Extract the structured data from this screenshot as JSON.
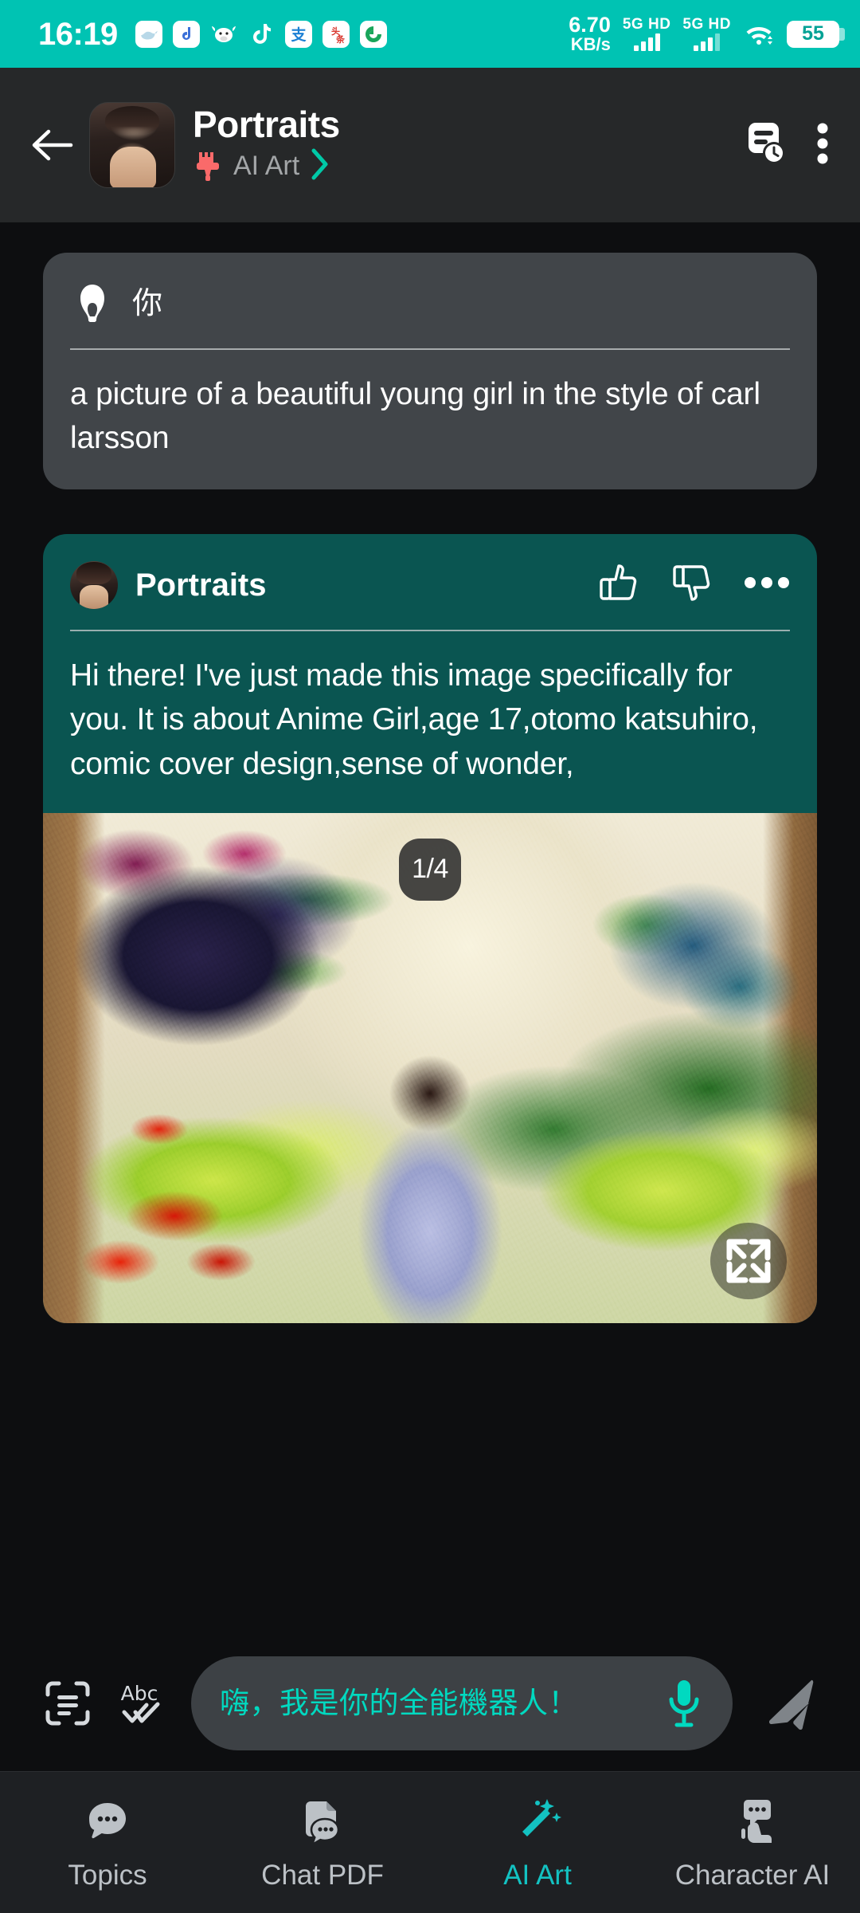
{
  "status_bar": {
    "time": "16:19",
    "app_icons": [
      "whale-app-icon",
      "note-app-icon",
      "cow-app-icon",
      "tiktok-app-icon",
      "alipay-app-icon",
      "toutiao-app-icon",
      "spiral-app-icon"
    ],
    "network_speed_value": "6.70",
    "network_speed_unit": "KB/s",
    "sim1_label": "5G HD",
    "sim2_label": "5G HD",
    "wifi_icon": "wifi-icon",
    "battery_level": "55",
    "background_color": "#00c3b3"
  },
  "header": {
    "back_icon": "back-arrow-icon",
    "avatar": "portraits-avatar",
    "title": "Portraits",
    "subtitle": "AI Art",
    "brush_icon": "paintbrush-icon",
    "chevron_icon": "chevron-right-icon",
    "history_icon": "chat-history-icon",
    "menu_icon": "more-vertical-icon",
    "brush_color": "#fa6a6a",
    "chevron_color": "#00c9a7",
    "background_color": "#262829"
  },
  "conversation": {
    "user_message": {
      "avatar_icon": "user-avatar-icon",
      "name": "你",
      "text": "a picture of a beautiful young girl in the style of carl larsson",
      "background_color": "#414549"
    },
    "bot_message": {
      "avatar": "portraits-avatar",
      "name": "Portraits",
      "like_icon": "thumbs-up-icon",
      "dislike_icon": "thumbs-down-icon",
      "more_icon": "more-horizontal-icon",
      "text": "Hi there! I've just made this image specifically for you. It is about Anime Girl,age 17,otomo katsuhiro, comic cover design,sense of wonder,",
      "background_color": "#0a5551",
      "image": {
        "page_indicator": "1/4",
        "expand_icon": "expand-fullscreen-icon",
        "alt": "impressionist painting of a girl in a light blue dress standing in a sunlit flower garden"
      }
    }
  },
  "input_bar": {
    "scan_icon": "scan-text-icon",
    "translate_icon": "abc-check-icon",
    "placeholder": "嗨，我是你的全能機器人！",
    "placeholder_color": "#00d9c0",
    "mic_icon": "microphone-icon",
    "send_icon": "send-arrow-icon",
    "field_background": "#3d4145"
  },
  "bottom_nav": {
    "items": [
      {
        "label": "Topics",
        "icon": "chat-bubble-icon",
        "active": false
      },
      {
        "label": "Chat PDF",
        "icon": "pdf-chat-icon",
        "active": false
      },
      {
        "label": "AI Art",
        "icon": "magic-wand-icon",
        "active": true
      },
      {
        "label": "Character AI",
        "icon": "character-bubble-icon",
        "active": false
      }
    ],
    "active_color": "#13c2c2",
    "inactive_color": "#bcc1c6",
    "background_color": "#1e2023"
  }
}
